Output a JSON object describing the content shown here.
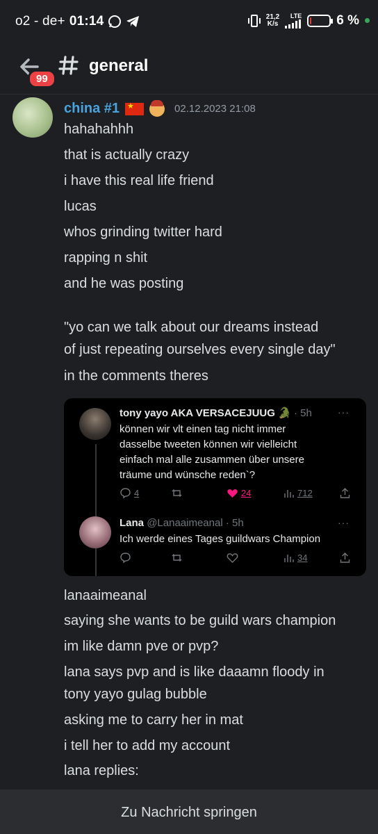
{
  "status_bar": {
    "carrier": "o2 - de+",
    "time": "01:14",
    "net_speed_top": "21,2",
    "net_speed_bottom": "K/s",
    "network_label": "LTE",
    "battery_text": "6 %",
    "battery_level": 0.06
  },
  "header": {
    "unread_badge": "99",
    "channel_name": "general"
  },
  "message": {
    "username": "china #1",
    "timestamp": "02.12.2023 21:08",
    "lines_before": [
      "hahahahhh",
      "that is actually crazy",
      "i have this real life friend",
      "lucas",
      "whos grinding twitter hard",
      "rapping n shit",
      "and he was posting",
      "\"yo can we talk about our dreams instead",
      "of just repeating ourselves every single day\"",
      "in the comments theres"
    ],
    "lines_after": [
      "lanaaimeanal",
      "saying she wants to be guild wars champion",
      "im like damn pve or pvp?",
      "lana says pvp and is like daaamn floody in",
      "tony yayo gulag bubble",
      "asking me to carry her in mat",
      "i tell her to add my account",
      "lana replies:"
    ]
  },
  "embed": {
    "tweet1": {
      "name": "tony yayo AKA VERSACEJUUG",
      "time": "· 5h",
      "text_lines": [
        "können wir vlt einen tag nicht immer",
        "dasselbe tweeten können wir vielleicht",
        "einfach mal alle zusammen über unsere",
        "träume und wünsche reden`?"
      ],
      "replies": "4",
      "likes": "24",
      "views": "712"
    },
    "tweet2": {
      "name": "Lana",
      "handle": "@Lanaaimeanal · 5h",
      "text": "Ich werde eines Tages guildwars Champion",
      "views": "34"
    }
  },
  "jump_bar": {
    "label": "Zu Nachricht springen"
  },
  "colors": {
    "background": "#1e1f22",
    "username": "#4aa3df",
    "badge": "#ed4245",
    "like": "#f91880"
  }
}
